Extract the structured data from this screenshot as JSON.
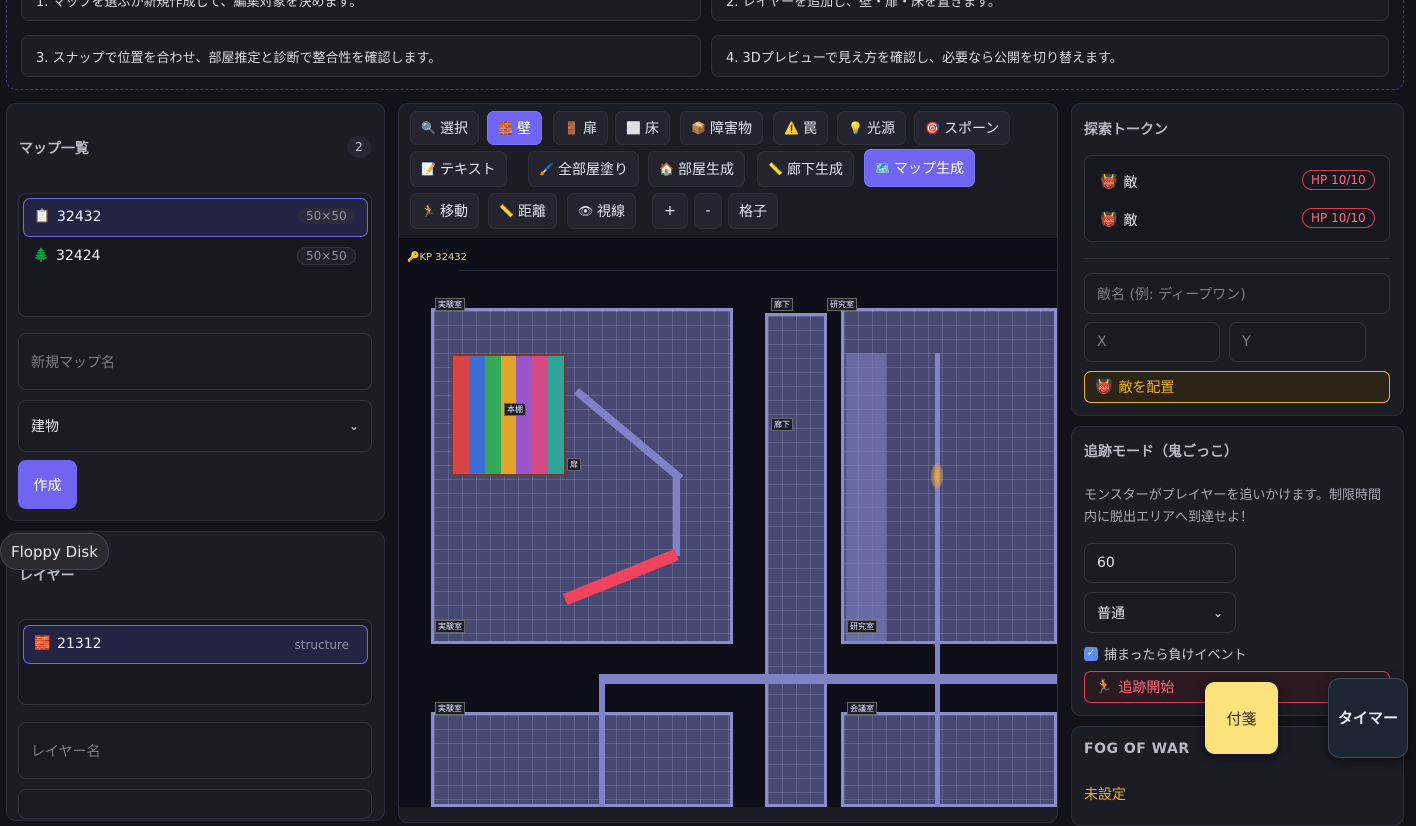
{
  "steps": [
    "1. マップを選ぶか新規作成して、編集対象を決めます。",
    "2. レイヤーを追加し、壁・扉・床を置きます。",
    "3. スナップで位置を合わせ、部屋推定と診断で整合性を確認します。",
    "4. 3Dプレビューで見え方を確認し、必要なら公開を切り替えます。"
  ],
  "map_list": {
    "title": "マップ一覧",
    "count": "2",
    "items": [
      {
        "icon": "📋",
        "name": "32432",
        "size": "50×50"
      },
      {
        "icon": "🌲",
        "name": "32424",
        "size": "50×50"
      }
    ],
    "new_name_placeholder": "新規マップ名",
    "type_select": "建物",
    "create_label": "作成"
  },
  "tooltip": "Floppy Disk",
  "layers": {
    "title": "レイヤー",
    "items": [
      {
        "icon": "🧱",
        "name": "21312",
        "type": "structure"
      }
    ],
    "name_placeholder": "レイヤー名"
  },
  "toolbar": {
    "row1": [
      {
        "icon": "🔍",
        "label": "選択",
        "active": false
      },
      {
        "icon": "🧱",
        "label": "壁",
        "active": true
      },
      {
        "icon": "🚪",
        "label": "扉",
        "active": false
      },
      {
        "icon": "⬜",
        "label": "床",
        "active": false
      },
      {
        "icon": "📦",
        "label": "障害物",
        "active": false
      },
      {
        "icon": "⚠️",
        "label": "罠",
        "active": false
      },
      {
        "icon": "💡",
        "label": "光源",
        "active": false
      },
      {
        "icon": "🎯",
        "label": "スポーン",
        "active": false
      }
    ],
    "row2": [
      {
        "icon": "📝",
        "label": "テキスト",
        "active": false
      },
      {
        "icon": "🖌️",
        "label": "全部屋塗り",
        "active": false
      },
      {
        "icon": "🏠",
        "label": "部屋生成",
        "active": false
      },
      {
        "icon": "📏",
        "label": "廊下生成",
        "active": false
      },
      {
        "icon": "🗺️",
        "label": "マップ生成",
        "active": true
      }
    ],
    "row3": [
      {
        "icon": "🏃",
        "label": "移動"
      },
      {
        "icon": "📏",
        "label": "距離"
      },
      {
        "icon": "👁",
        "label": "視線"
      }
    ],
    "zoom_in": "+",
    "zoom_out": "-",
    "grid": "格子"
  },
  "canvas": {
    "map_label": "KP 32432"
  },
  "tokens": {
    "title": "探索トークン",
    "items": [
      {
        "icon": "👹",
        "name": "敵",
        "hp": "HP 10/10"
      },
      {
        "icon": "👹",
        "name": "敵",
        "hp": "HP 10/10"
      }
    ],
    "enemy_name_placeholder": "敵名 (例: ディープワン)",
    "x_placeholder": "X",
    "y_placeholder": "Y",
    "place_label": "敵を配置"
  },
  "chase": {
    "title": "追跡モード（鬼ごっこ）",
    "description": "モンスターがプレイヤーを追いかけます。制限時間内に脱出エリアへ到達せよ！",
    "time_value": "60",
    "difficulty": "普通",
    "lose_event_label": "捕まったら負けイベント",
    "start_label": "追跡開始"
  },
  "fog": {
    "title": "FOG OF WAR",
    "status": "未設定"
  },
  "floating": {
    "sticky": "付箋",
    "timer": "タイマー"
  },
  "colors": {
    "accent": "#6f65f0",
    "danger": "#e0394f",
    "warning": "#f2b01e"
  }
}
